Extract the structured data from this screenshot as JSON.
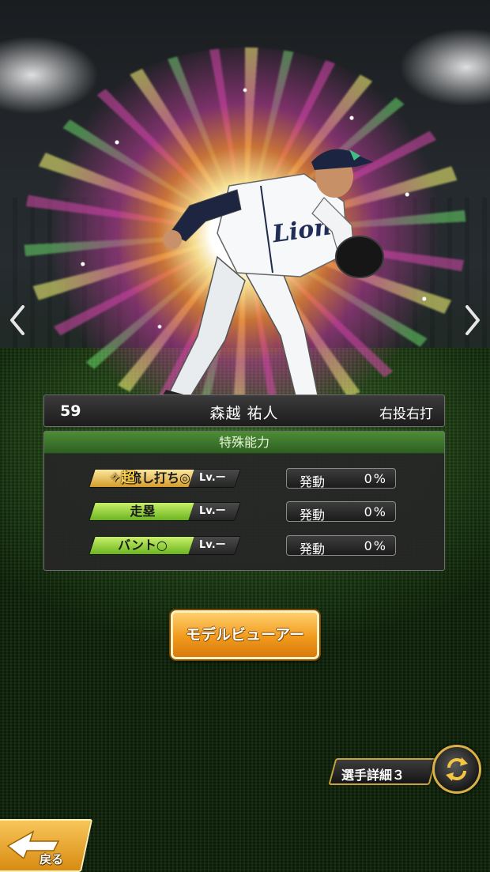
{
  "player": {
    "number": "59",
    "name": "森越 祐人",
    "handedness": "右投右打",
    "team_logo_text": "Lions"
  },
  "abilities": {
    "header": "特殊能力",
    "super_badge": "超",
    "lv_label": "Lv.ー",
    "activation_label": "発動",
    "items": [
      {
        "name": "流し打ち◎",
        "tier": "super",
        "activation_value": "0%"
      },
      {
        "name": "走塁",
        "tier": "normal",
        "activation_value": "0%"
      },
      {
        "name": "バント○",
        "tier": "normal",
        "activation_value": "0%"
      }
    ]
  },
  "buttons": {
    "model_viewer": "モデルビューアー",
    "player_detail": "選手詳細３",
    "back": "戻る"
  },
  "icons": {
    "prev": "chevron-left-icon",
    "next": "chevron-right-icon",
    "swap": "swap-arrows-icon",
    "back": "back-arrow-icon"
  },
  "colors": {
    "ability_header": "#3d7a2c",
    "super_skill": "#e9b948",
    "normal_skill": "#9ad943",
    "model_button": "#f29a1c",
    "accent_gold": "#d9b045"
  }
}
